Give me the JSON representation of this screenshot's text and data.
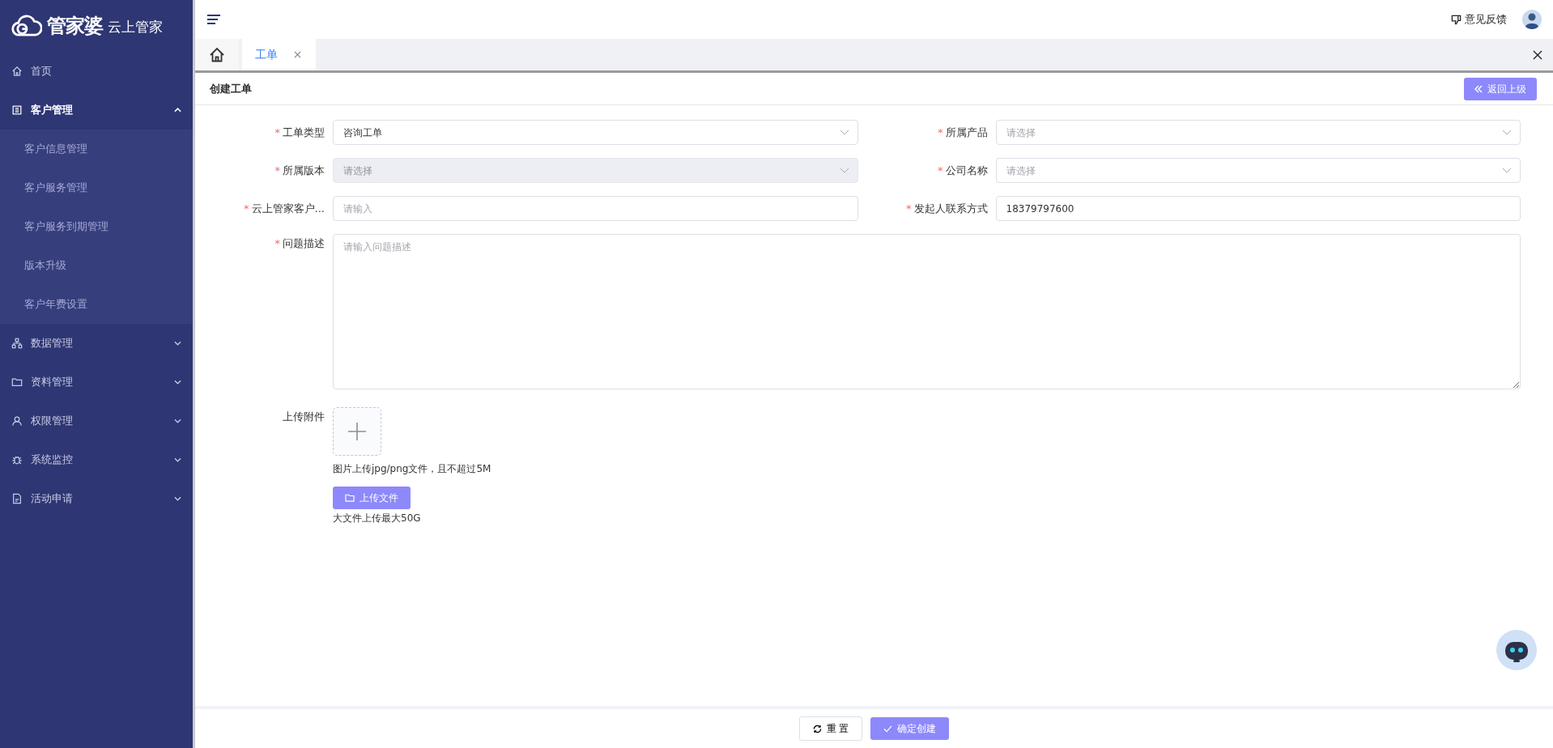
{
  "logo": {
    "brand": "管家婆",
    "sub": "云上管家"
  },
  "sidebar": {
    "items": [
      {
        "label": "首页",
        "kind": "link"
      },
      {
        "label": "客户管理",
        "kind": "group",
        "expanded": true,
        "children": [
          {
            "label": "客户信息管理"
          },
          {
            "label": "客户服务管理"
          },
          {
            "label": "客户服务到期管理"
          },
          {
            "label": "版本升级"
          },
          {
            "label": "客户年费设置"
          }
        ]
      },
      {
        "label": "数据管理",
        "kind": "group",
        "expanded": false
      },
      {
        "label": "资料管理",
        "kind": "group",
        "expanded": false
      },
      {
        "label": "权限管理",
        "kind": "group",
        "expanded": false
      },
      {
        "label": "系统监控",
        "kind": "group",
        "expanded": false
      },
      {
        "label": "活动申请",
        "kind": "group",
        "expanded": false
      }
    ]
  },
  "header": {
    "feedback": "意见反馈"
  },
  "tabs": [
    {
      "kind": "home",
      "selected": false
    },
    {
      "kind": "page",
      "label": "工单",
      "selected": true
    }
  ],
  "page": {
    "title": "创建工单",
    "back_button": "返回上级"
  },
  "form": {
    "fields": [
      {
        "required_mark": "*",
        "label": "工单类型",
        "kind": "select",
        "value": "咨询工单",
        "disabled": false
      },
      {
        "required_mark": "*",
        "label": "所属产品",
        "kind": "select",
        "placeholder": "请选择",
        "disabled": false
      },
      {
        "required_mark": "*",
        "label": "所属版本",
        "kind": "select",
        "placeholder": "请选择",
        "disabled": true
      },
      {
        "required_mark": "*",
        "label": "公司名称",
        "kind": "select",
        "placeholder": "请选择",
        "disabled": false
      },
      {
        "required_mark": "*",
        "label": "云上管家客户...",
        "kind": "input",
        "placeholder": "请输入",
        "disabled": false
      },
      {
        "required_mark": "*",
        "label": "发起人联系方式",
        "kind": "input",
        "value": "18379797600",
        "disabled": false
      },
      {
        "required_mark": "*",
        "label": "问题描述",
        "kind": "textarea",
        "placeholder": "请输入问题描述",
        "disabled": false
      }
    ],
    "upload": {
      "label": "上传附件",
      "image_hint": "图片上传jpg/png文件，且不超过5M",
      "file_button": "上传文件",
      "file_hint": "大文件上传最大50G"
    }
  },
  "footer": {
    "buttons": [
      {
        "label": "重 置",
        "kind": "default"
      },
      {
        "label": "确定创建",
        "kind": "primary"
      }
    ]
  }
}
